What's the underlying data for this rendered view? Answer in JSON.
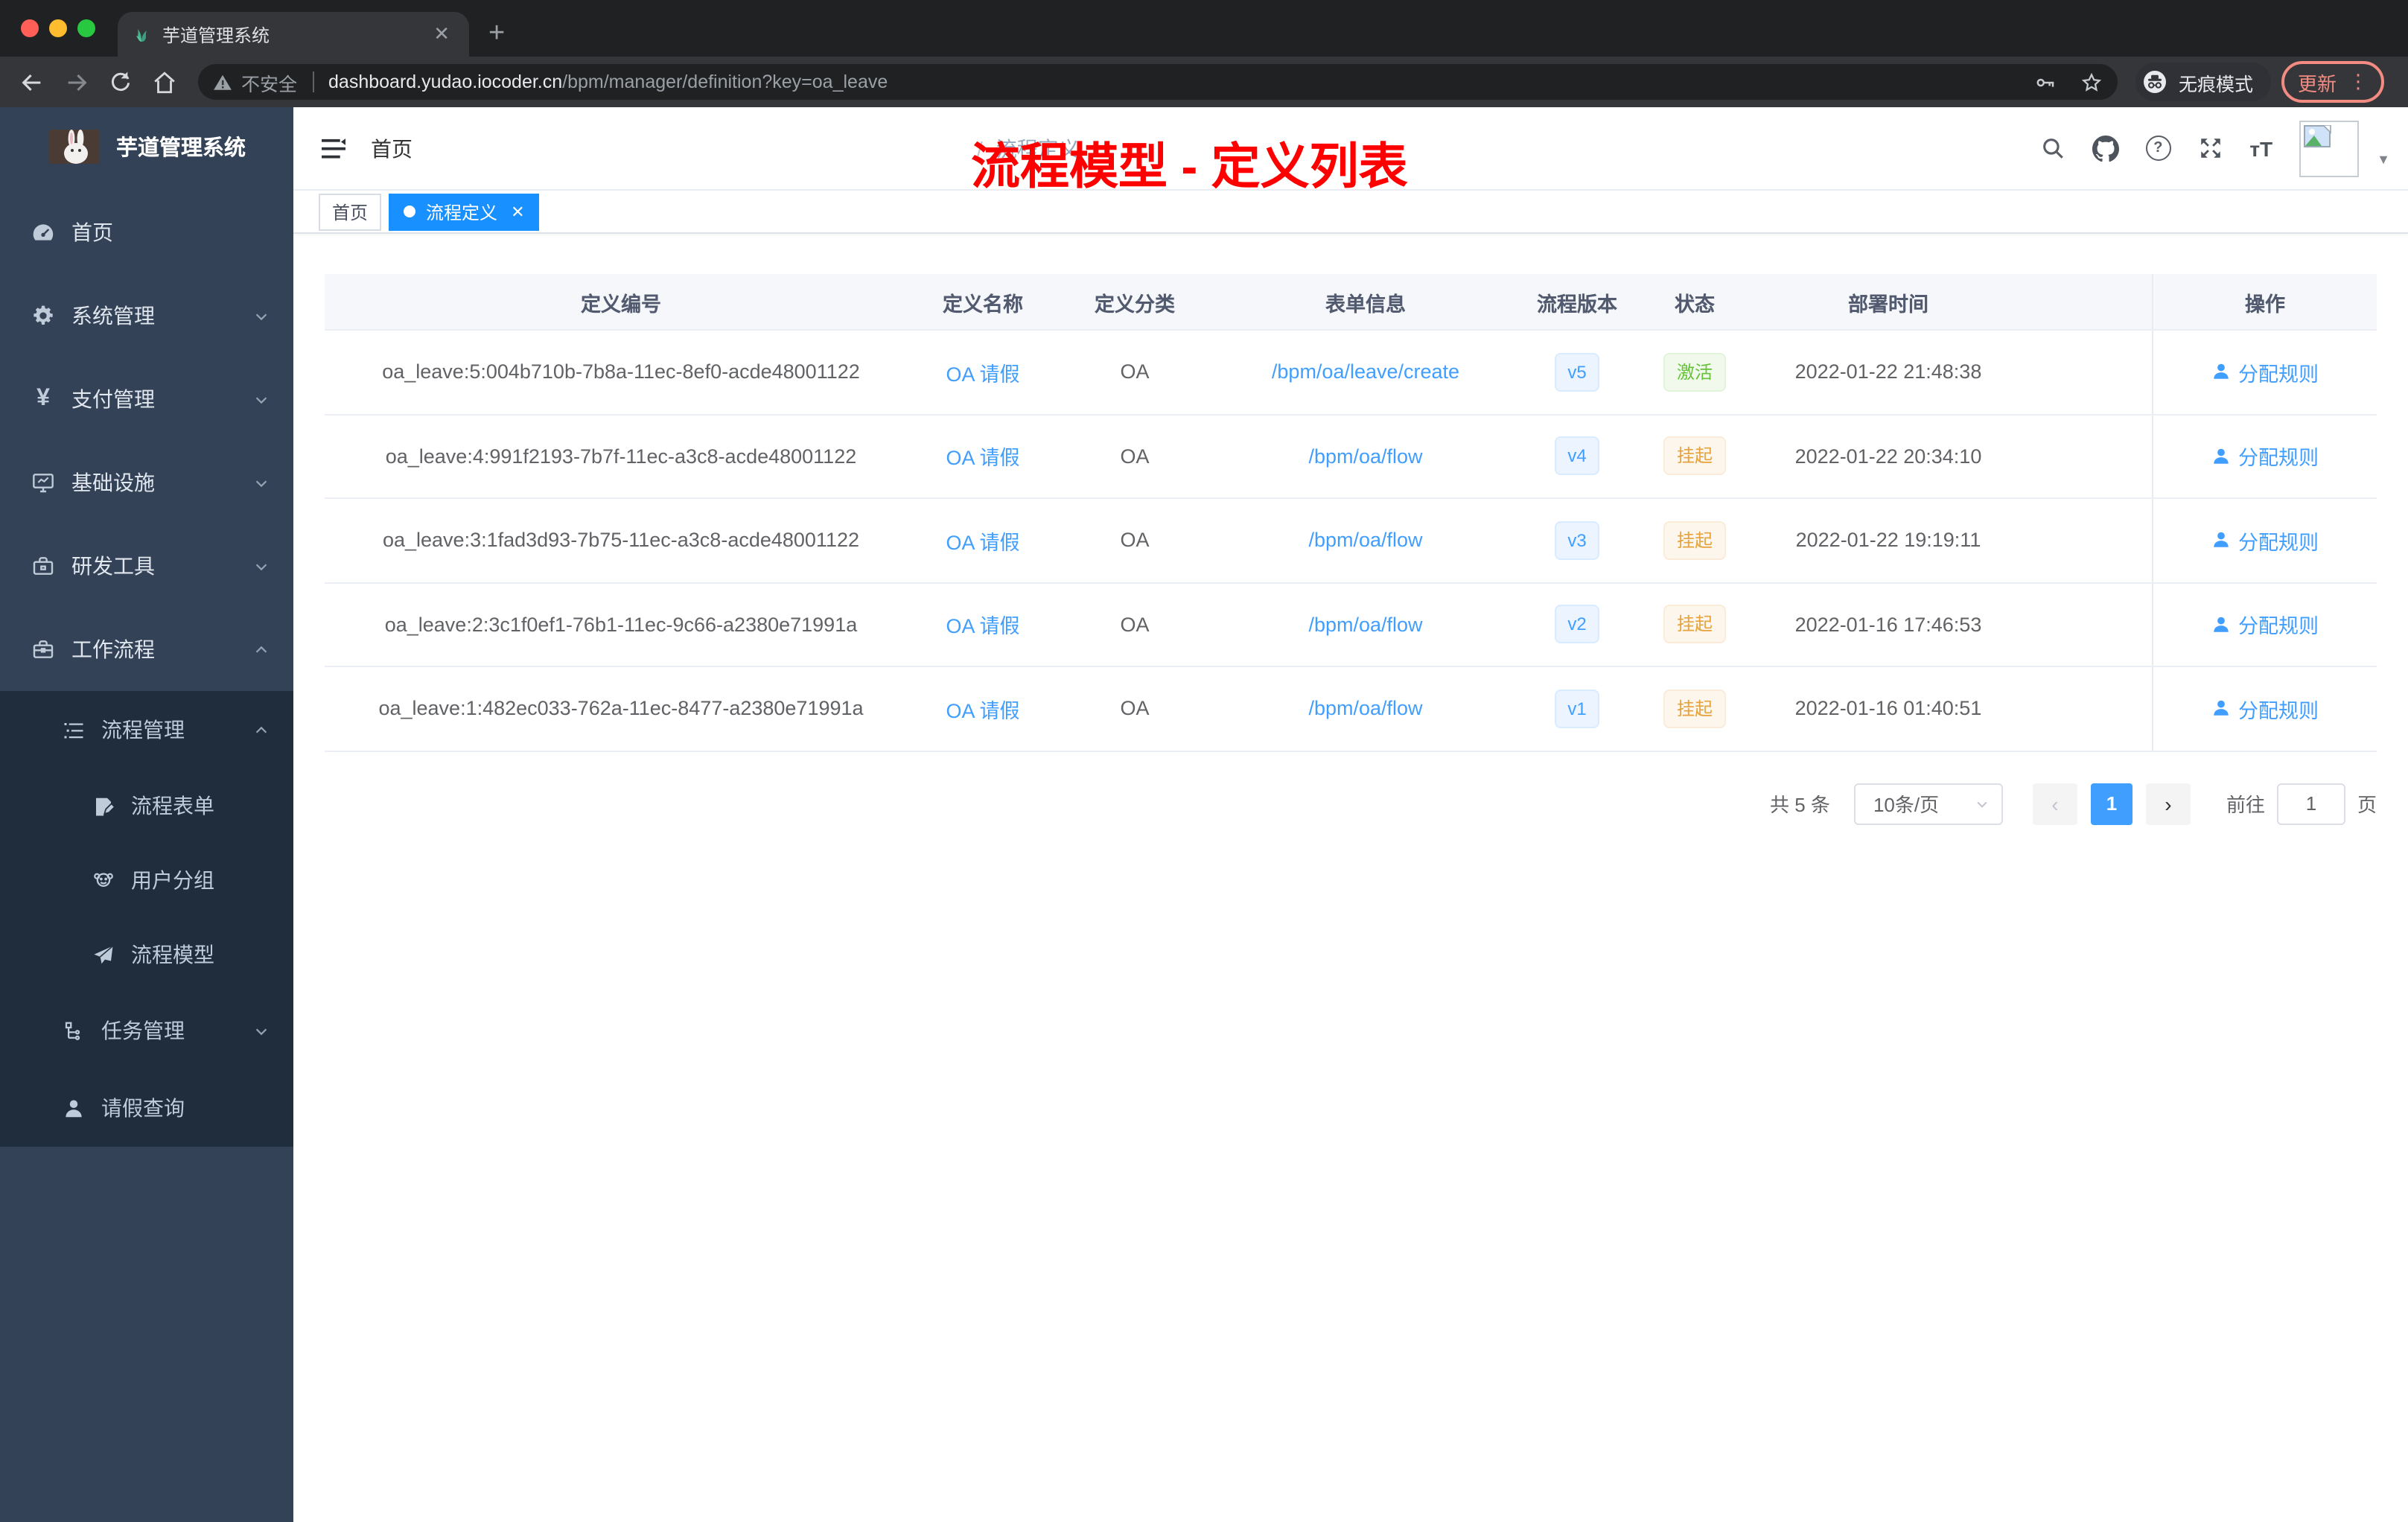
{
  "browser": {
    "tab_title": "芋道管理系统",
    "address": {
      "security_label": "不安全",
      "domain": "dashboard.yudao.iocoder.cn",
      "path": "/bpm/manager/definition?key=oa_leave"
    },
    "incognito_label": "无痕模式",
    "update_label": "更新"
  },
  "sidebar": {
    "logo_title": "芋道管理系统",
    "items": [
      {
        "label": "首页"
      },
      {
        "label": "系统管理"
      },
      {
        "label": "支付管理"
      },
      {
        "label": "基础设施"
      },
      {
        "label": "研发工具"
      },
      {
        "label": "工作流程"
      }
    ],
    "workflow_children": [
      {
        "label": "流程管理"
      },
      {
        "label": "流程表单"
      },
      {
        "label": "用户分组"
      },
      {
        "label": "流程模型"
      },
      {
        "label": "任务管理"
      },
      {
        "label": "请假查询"
      }
    ]
  },
  "navbar": {
    "breadcrumb": [
      "首页",
      "流程定义"
    ],
    "separator": "/"
  },
  "annotation": {
    "text": "流程模型 - 定义列表",
    "color": "#ff0000"
  },
  "tags": [
    {
      "label": "首页",
      "active": false
    },
    {
      "label": "流程定义",
      "active": true
    }
  ],
  "table": {
    "columns": [
      "定义编号",
      "定义名称",
      "定义分类",
      "表单信息",
      "流程版本",
      "状态",
      "部署时间",
      "操作"
    ],
    "action_label": "分配规则",
    "rows": [
      {
        "id": "oa_leave:5:004b710b-7b8a-11ec-8ef0-acde48001122",
        "name": "OA 请假",
        "category": "OA",
        "form": "/bpm/oa/leave/create",
        "version": "v5",
        "status": "激活",
        "status_type": "active",
        "deployed_at": "2022-01-22 21:48:38"
      },
      {
        "id": "oa_leave:4:991f2193-7b7f-11ec-a3c8-acde48001122",
        "name": "OA 请假",
        "category": "OA",
        "form": "/bpm/oa/flow",
        "version": "v4",
        "status": "挂起",
        "status_type": "suspended",
        "deployed_at": "2022-01-22 20:34:10"
      },
      {
        "id": "oa_leave:3:1fad3d93-7b75-11ec-a3c8-acde48001122",
        "name": "OA 请假",
        "category": "OA",
        "form": "/bpm/oa/flow",
        "version": "v3",
        "status": "挂起",
        "status_type": "suspended",
        "deployed_at": "2022-01-22 19:19:11"
      },
      {
        "id": "oa_leave:2:3c1f0ef1-76b1-11ec-9c66-a2380e71991a",
        "name": "OA 请假",
        "category": "OA",
        "form": "/bpm/oa/flow",
        "version": "v2",
        "status": "挂起",
        "status_type": "suspended",
        "deployed_at": "2022-01-16 17:46:53"
      },
      {
        "id": "oa_leave:1:482ec033-762a-11ec-8477-a2380e71991a",
        "name": "OA 请假",
        "category": "OA",
        "form": "/bpm/oa/flow",
        "version": "v1",
        "status": "挂起",
        "status_type": "suspended",
        "deployed_at": "2022-01-16 01:40:51"
      }
    ]
  },
  "pagination": {
    "total_label": "共 5 条",
    "page_size_value": "10条/页",
    "current_page": "1",
    "goto_label": "前往",
    "goto_value": "1",
    "page_unit_label": "页"
  },
  "colors": {
    "accent_link": "#409eff",
    "tag_active": "#1890ff",
    "status_active": "#67c23a",
    "status_suspended": "#e6a23c",
    "sidebar_bg": "#344257",
    "sidebar_submenu_bg": "#1f2d3d",
    "annotation": "#ff0000",
    "update_button": "#f28b82"
  }
}
